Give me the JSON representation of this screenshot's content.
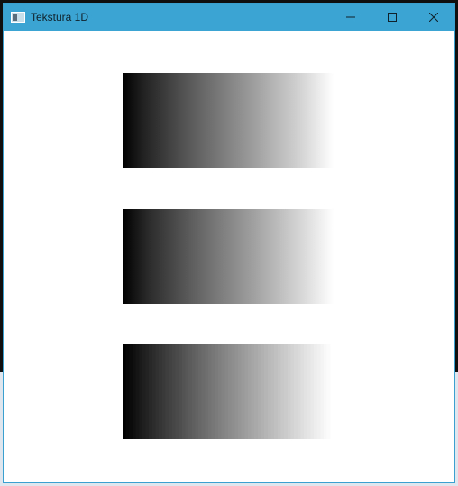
{
  "window": {
    "title": "Tekstura 1D",
    "titlebar_color": "#3ba4d2",
    "icons": {
      "app": "app-window-icon",
      "minimize": "minimize-icon",
      "maximize": "maximize-icon",
      "close": "close-icon"
    }
  },
  "content": {
    "gradients": [
      {
        "name": "smooth-gradient",
        "from": "#000000",
        "to": "#ffffff"
      },
      {
        "name": "smooth-gradient-2",
        "from": "#000000",
        "to": "#ffffff"
      },
      {
        "name": "banded-gradient",
        "from": "#000000",
        "to": "#ffffff",
        "bands": 64
      }
    ]
  }
}
